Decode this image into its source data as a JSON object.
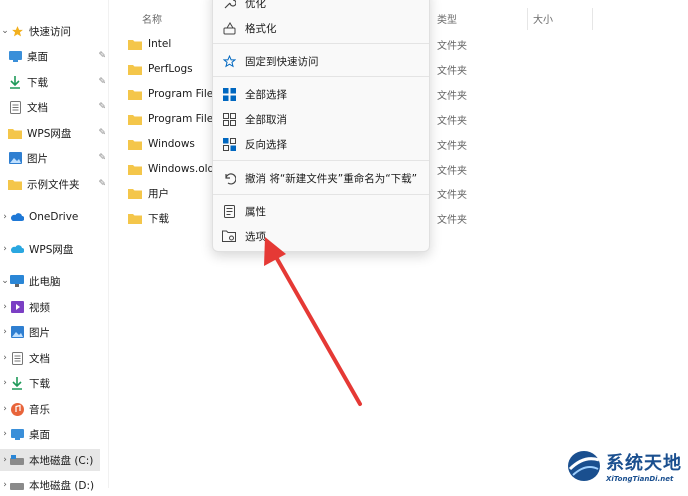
{
  "sidebar": {
    "quick_access": "快速访问",
    "desktop": "桌面",
    "downloads": "下载",
    "documents": "文档",
    "wps_drive": "WPS网盘",
    "pictures": "图片",
    "example_folder": "示例文件夹",
    "onedrive": "OneDrive",
    "wps_cloud": "WPS网盘",
    "this_pc": "此电脑",
    "videos": "视频",
    "pc_pictures": "图片",
    "pc_documents": "文档",
    "pc_downloads": "下载",
    "music": "音乐",
    "pc_desktop": "桌面",
    "local_c": "本地磁盘 (C:)",
    "local_d": "本地磁盘 (D:)"
  },
  "columns": {
    "name": "名称",
    "type": "类型",
    "size": "大小"
  },
  "files": [
    {
      "name": "Intel",
      "type": "文件夹"
    },
    {
      "name": "PerfLogs",
      "type": "文件夹"
    },
    {
      "name": "Program Files",
      "type": "文件夹"
    },
    {
      "name": "Program Files",
      "type": "文件夹"
    },
    {
      "name": "Windows",
      "type": "文件夹"
    },
    {
      "name": "Windows.old",
      "type": "文件夹"
    },
    {
      "name": "用户",
      "type": "文件夹"
    },
    {
      "name": "下载",
      "type": "文件夹"
    }
  ],
  "menu": {
    "optimize": "优化",
    "format": "格式化",
    "pin_quick_access": "固定到快速访问",
    "select_all": "全部选择",
    "select_none": "全部取消",
    "invert_selection": "反向选择",
    "undo_rename": "撤消 将“新建文件夹”重命名为“下载”",
    "properties": "属性",
    "options": "选项"
  },
  "watermark": {
    "title": "系统天地",
    "sub": "XiTongTianDi.net"
  },
  "colors": {
    "folder": "#f4c64a",
    "accent": "#0067c0",
    "arrow": "#e53935",
    "brand": "#1a4f8f"
  }
}
